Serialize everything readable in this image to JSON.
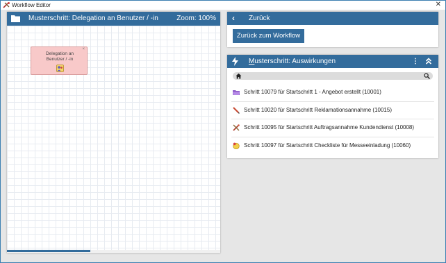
{
  "window": {
    "title": "Workflow Editor",
    "close_glyph": "✕"
  },
  "editor": {
    "icon": "folder-icon",
    "title": "Musterschritt: Delegation an Benutzer / -in",
    "zoom": "Zoom: 100%",
    "node": {
      "line1": "Delegation an",
      "line2": "Benutzer / -in",
      "close": "×",
      "icon": "user-task-icon"
    }
  },
  "back_panel": {
    "header_label": "Zurück",
    "button_label": "Zurück zum Workflow"
  },
  "effects_panel": {
    "title_prefix": "M",
    "title_rest": "usterschritt: Auswirkungen",
    "kebab": "⋮",
    "items": [
      {
        "icon": "folder-purple-icon",
        "label": "Schritt 10079 für Startschritt 1 - Angebot erstellt (10001)"
      },
      {
        "icon": "pen-icon",
        "label": "Schritt 10020 für Startschritt Reklamationsannahme (10015)"
      },
      {
        "icon": "tools-icon",
        "label": "Schritt 10095 für Startschritt Auftragsannahme Kundendienst (10008)"
      },
      {
        "icon": "checklist-icon",
        "label": "Schritt 10097 für Startschritt Checkliste für Messeeinladung (10060)"
      }
    ]
  },
  "colors": {
    "accent": "#336c9c",
    "node_fill": "#f8c9c9",
    "background": "#e6e6e6"
  }
}
